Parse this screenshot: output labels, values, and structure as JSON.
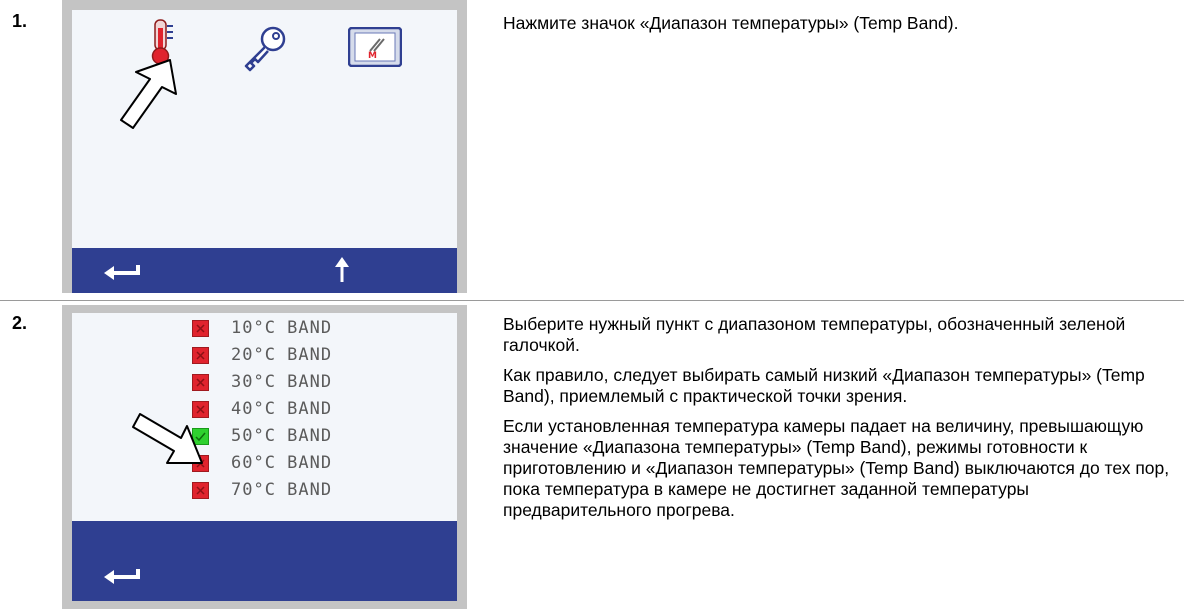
{
  "steps": [
    {
      "number": "1.",
      "paragraphs": [
        "Нажмите значок «Диапазон температуры» (Temp Band)."
      ]
    },
    {
      "number": "2.",
      "paragraphs": [
        "Выберите нужный пункт с диапазоном температуры, обозначенный зеленой галочкой.",
        "Как правило, следует выбирать самый низкий «Диапазон температуры» (Temp Band), приемлемый с практической точки зрения.",
        "Если установленная температура камеры падает на величину, превышающую значение «Диапазона температуры» (Temp Band), режимы готовности к приготовлению и «Диапазон температуры» (Temp Band) выключаются до тех пор, пока температура в камере не достигнет заданной температуры предварительного прогрева."
      ]
    }
  ],
  "screen1": {
    "icons": [
      "thermometer-icon",
      "key-icon",
      "m-logo-screen-icon",
      "pointer-arrow-icon"
    ],
    "navbar_icons": [
      "back-arrow-icon",
      "up-arrow-icon"
    ]
  },
  "screen2": {
    "bands": [
      {
        "label": "10°C BAND",
        "selected": false
      },
      {
        "label": "20°C BAND",
        "selected": false
      },
      {
        "label": "30°C BAND",
        "selected": false
      },
      {
        "label": "40°C BAND",
        "selected": false
      },
      {
        "label": "50°C BAND",
        "selected": true
      },
      {
        "label": "60°C BAND",
        "selected": false
      },
      {
        "label": "70°C BAND",
        "selected": false
      }
    ],
    "navbar_icons": [
      "back-arrow-icon"
    ]
  },
  "colors": {
    "navbar": "#2f3f91",
    "band_off": "#e0232d",
    "band_on": "#2fd12f",
    "thermometer": "#e0232d"
  }
}
